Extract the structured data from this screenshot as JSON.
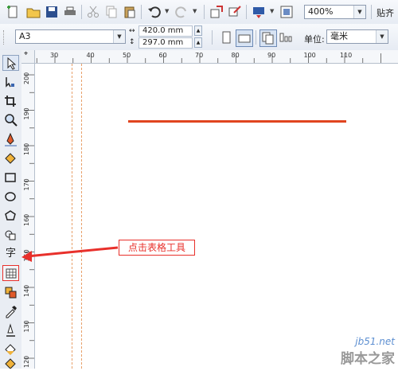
{
  "toolbar1": {
    "zoom_value": "400%",
    "snap_label": "贴齐"
  },
  "toolbar2": {
    "paper_size": "A3",
    "width_value": "420.0 mm",
    "height_value": "297.0 mm",
    "unit_label": "单位:",
    "unit_value": "毫米"
  },
  "h_ruler": {
    "ticks": [
      "30",
      "40",
      "50",
      "60",
      "70",
      "80",
      "90",
      "100",
      "110"
    ]
  },
  "v_ruler": {
    "ticks": [
      "200",
      "190",
      "180",
      "170",
      "160",
      "150",
      "140",
      "130",
      "120"
    ]
  },
  "tools": [
    "pick-tool",
    "shape-tool",
    "crop-tool",
    "zoom-tool",
    "freehand-tool",
    "smart-fill-tool",
    "rectangle-tool",
    "ellipse-tool",
    "polygon-tool",
    "basic-shapes-tool",
    "text-tool",
    "table-tool",
    "interactive-tool",
    "eyedropper-tool",
    "outline-tool",
    "fill-tool",
    "interactive-fill-tool"
  ],
  "text_tool_glyph": "字",
  "annotation": {
    "label": "点击表格工具",
    "color": "#e8302b"
  },
  "canvas": {
    "line_color": "#e0441f"
  },
  "watermark": {
    "site": "jb51.net",
    "name": "脚本之家"
  }
}
